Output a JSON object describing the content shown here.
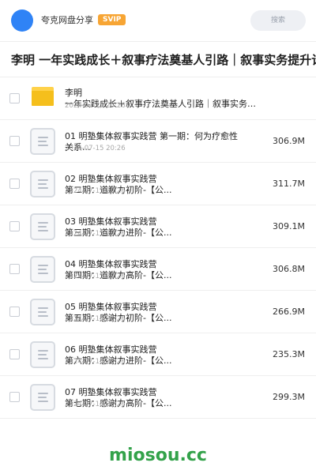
{
  "header": {
    "share_name": "夸克网盘分享",
    "badge": "SVIP",
    "search_placeholder": "搜索"
  },
  "title": "李明 一年实践成长＋叙事疗法奠基人引路｜叙事实务提升计划",
  "files": [
    {
      "type": "folder",
      "name_line1": "李明",
      "name_line2": "一年实践成长＋叙事疗法奠基人引路｜叙事实务提...",
      "date": "2024-07-15 20:26",
      "size": ""
    },
    {
      "type": "file",
      "name_line1": "01 明塾集体叙事实践营 第一期：何为疗愈性",
      "name_line2": "关系...",
      "date": "2024-07-15 20:26",
      "size": "306.9M"
    },
    {
      "type": "file",
      "name_line1": "02 明塾集体叙事实践营",
      "name_line2": "第二期：道歉力初阶-【公...",
      "date": "2024-07-15 20:26",
      "size": "311.7M"
    },
    {
      "type": "file",
      "name_line1": "03 明塾集体叙事实践营",
      "name_line2": "第三期：道歉力进阶-【公...",
      "date": "2024-07-15 20:26",
      "size": "309.1M"
    },
    {
      "type": "file",
      "name_line1": "04 明塾集体叙事实践营",
      "name_line2": "第四期：道歉力高阶-【公...",
      "date": "2024-07-15 20:26",
      "size": "306.8M"
    },
    {
      "type": "file",
      "name_line1": "05 明塾集体叙事实践营",
      "name_line2": "第五期：感谢力初阶-【公...",
      "date": "2024-07-15 20:26",
      "size": "266.9M"
    },
    {
      "type": "file",
      "name_line1": "06 明塾集体叙事实践营",
      "name_line2": "第六期：感谢力进阶-【公...",
      "date": "2024-07-15 20:26",
      "size": "235.3M"
    },
    {
      "type": "file",
      "name_line1": "07 明塾集体叙事实践营",
      "name_line2": "第七期：感谢力高阶-【公...",
      "date": "2024-07-15 20:26",
      "size": "299.3M"
    }
  ],
  "footer": {
    "brand": "miosou.cc"
  },
  "colors": {
    "accent": "#2f83f6",
    "svip": "#f7a534",
    "folder": "#f5bf1c",
    "brand": "#33a24a"
  }
}
